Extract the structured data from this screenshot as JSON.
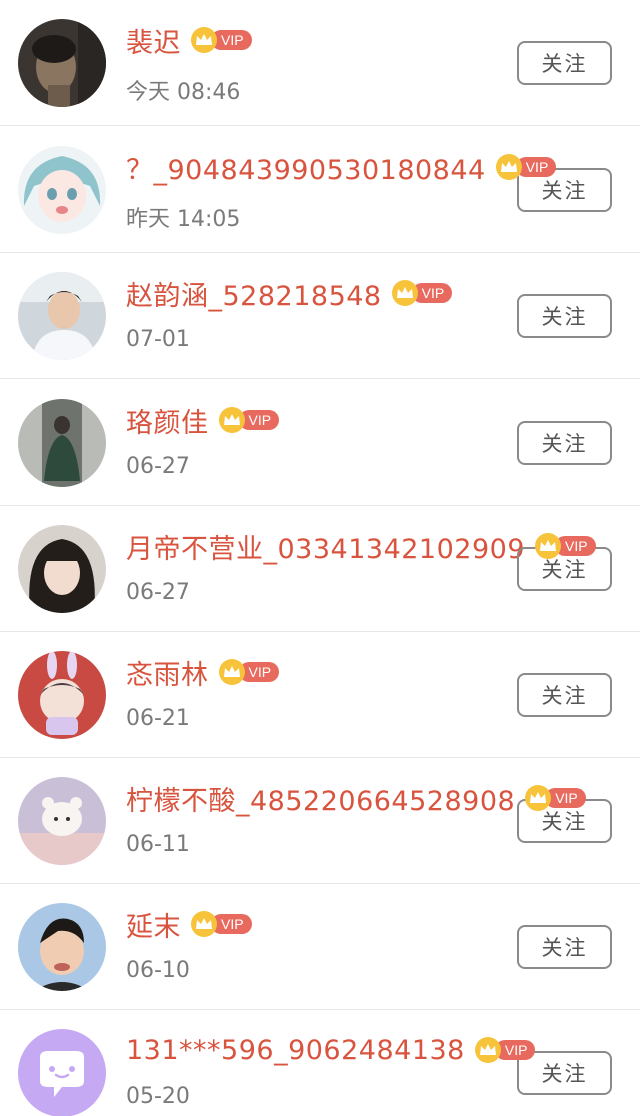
{
  "follow_label": "关注",
  "vip_label": "VIP",
  "colors": {
    "name": "#d8543e",
    "vip_tag": "#e86a5e",
    "crown": "#f6c33a",
    "time": "#7a7a7a"
  },
  "users": [
    {
      "name": "裴迟",
      "time": "今天 08:46",
      "avatar_icon": "dark-portrait"
    },
    {
      "name": "？_904843990530180844",
      "time": "昨天 14:05",
      "avatar_icon": "anime-girl"
    },
    {
      "name": "赵韵涵_528218548",
      "time": "07-01",
      "avatar_icon": "young-man-portrait"
    },
    {
      "name": "珞颜佳",
      "time": "06-27",
      "avatar_icon": "girl-in-dress"
    },
    {
      "name": "月帝不营业_03341342102909",
      "time": "06-27",
      "avatar_icon": "girl-portrait"
    },
    {
      "name": "忞雨林",
      "time": "06-21",
      "avatar_icon": "cartoon-bunny-boy"
    },
    {
      "name": "柠檬不酸_485220664528908",
      "time": "06-11",
      "avatar_icon": "cartoon-bear-bath"
    },
    {
      "name": "延末",
      "time": "06-10",
      "avatar_icon": "child-portrait"
    },
    {
      "name": "131***596_9062484138",
      "time": "05-20",
      "avatar_icon": "chat-bubble"
    }
  ]
}
